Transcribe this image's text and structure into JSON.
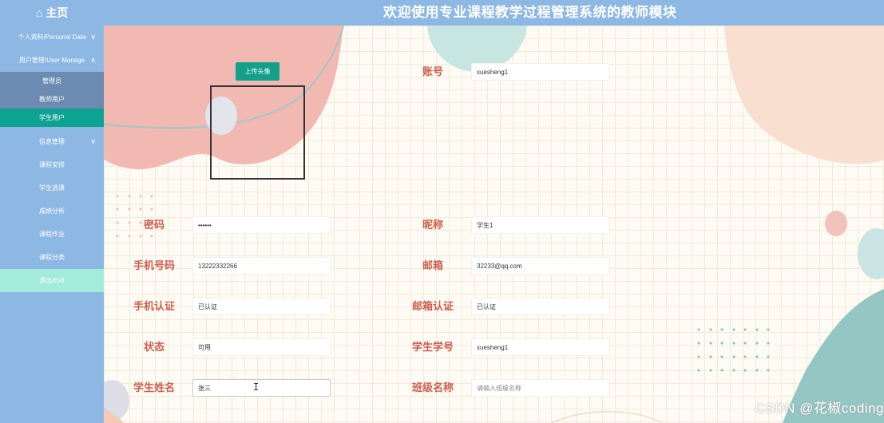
{
  "header": {
    "home_icon": "⌂",
    "home_label": "主页",
    "title": "欢迎使用专业课程教学过程管理系统的教师模块"
  },
  "sidebar": {
    "items": [
      {
        "label": "个人资料/Personal Data",
        "chevron": "∨"
      },
      {
        "label": "用户管理/User Manage",
        "chevron": "∧"
      },
      {
        "label": "信息管理",
        "chevron": "∨"
      },
      {
        "label": "课程安排"
      },
      {
        "label": "学生选课"
      },
      {
        "label": "成绩分析"
      },
      {
        "label": "课程作业"
      },
      {
        "label": "课程分类"
      },
      {
        "label": "退出/Exit"
      }
    ],
    "subitems": [
      {
        "label": "管理员"
      },
      {
        "label": "教师用户"
      },
      {
        "label": "学生用户"
      }
    ]
  },
  "avatar": {
    "upload_label": "上传头像"
  },
  "form": {
    "account_label": "账号",
    "account_value": "xuesheng1",
    "password_label": "密码",
    "password_value": "••••••",
    "nickname_label": "昵称",
    "nickname_value": "学生1",
    "phone_label": "手机号码",
    "phone_value": "13222332266",
    "email_label": "邮箱",
    "email_value": "32233@qq.com",
    "phone_verify_label": "手机认证",
    "phone_verify_value": "已认证",
    "email_verify_label": "邮箱认证",
    "email_verify_value": "已认证",
    "status_label": "状态",
    "status_value": "可用",
    "student_no_label": "学生学号",
    "student_no_value": "xuesheng1",
    "student_name_label": "学生姓名",
    "student_name_value": "张三",
    "class_label": "班级名称",
    "class_placeholder": "请输入班级名称"
  },
  "cursor": "I",
  "watermark": "CSDN @花椒coding",
  "colors": {
    "header_bg": "#8db8e3",
    "submenu_bg": "#6b8bb0",
    "active_item": "#0ea292",
    "exit_item": "#a3ecdc",
    "label_color": "#cd5e50",
    "upload_button": "#12a08a"
  }
}
